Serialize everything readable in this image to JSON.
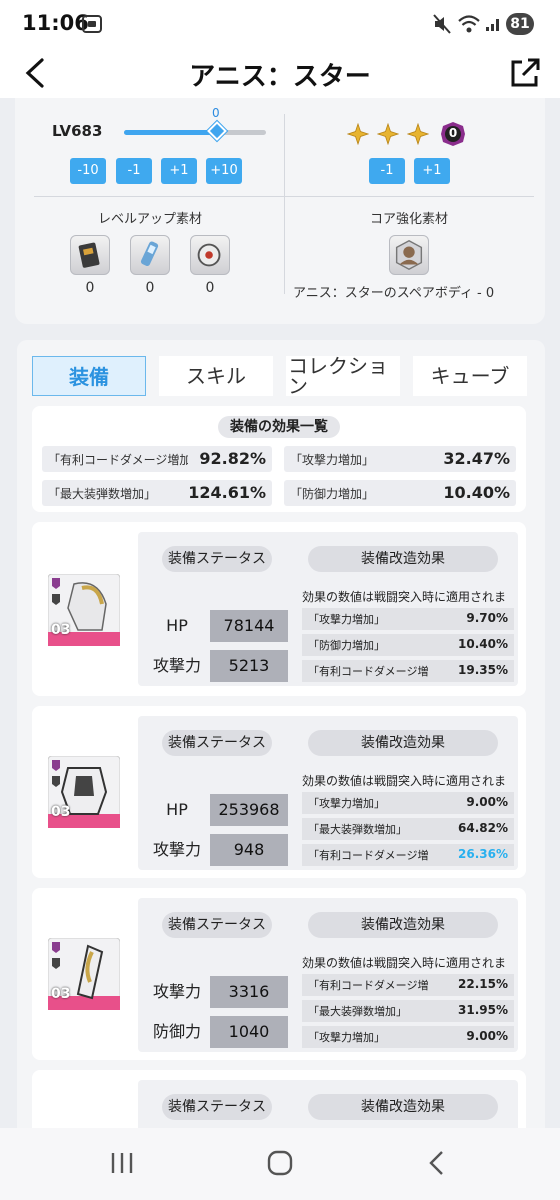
{
  "status": {
    "time": "11:06",
    "battery": "81"
  },
  "header": {
    "title": "アニス：スター"
  },
  "level": {
    "label": "LV683",
    "slider_value": "0",
    "slider_fraction": 0.62,
    "buttons": [
      "-10",
      "-1",
      "+1",
      "+10"
    ]
  },
  "core": {
    "stars": 3,
    "core_level": "0",
    "buttons": [
      "-1",
      "+1"
    ]
  },
  "levelup_materials": {
    "label": "レベルアップ素材",
    "counts": [
      "0",
      "0",
      "0"
    ]
  },
  "core_materials": {
    "label": "コア強化素材",
    "item_label": "アニス：スターのスペアボディ - 0"
  },
  "tabs": [
    "装備",
    "スキル",
    "コレクション",
    "キューブ"
  ],
  "summary": {
    "title": "装備の効果一覧",
    "rows": [
      {
        "label": "「有利コードダメージ増加",
        "value": "92.82%"
      },
      {
        "label": "「攻撃力増加」",
        "value": "32.47%"
      },
      {
        "label": "「最大装弾数増加」",
        "value": "124.61%"
      },
      {
        "label": "「防御力増加」",
        "value": "10.40%"
      }
    ]
  },
  "gear_common": {
    "stats_title": "装備ステータス",
    "effects_title": "装備改造効果",
    "note": "効果の数値は戦闘突入時に適用されま",
    "level_tag": "03"
  },
  "gears": [
    {
      "stats": [
        {
          "label": "HP",
          "value": "78144"
        },
        {
          "label": "攻撃力",
          "value": "5213"
        }
      ],
      "effects": [
        {
          "label": "「攻撃力増加」",
          "value": "9.70%",
          "hi": false
        },
        {
          "label": "「防御力増加」",
          "value": "10.40%",
          "hi": false
        },
        {
          "label": "「有利コードダメージ増",
          "value": "19.35%",
          "hi": false
        }
      ]
    },
    {
      "stats": [
        {
          "label": "HP",
          "value": "253968"
        },
        {
          "label": "攻撃力",
          "value": "948"
        }
      ],
      "effects": [
        {
          "label": "「攻撃力増加」",
          "value": "9.00%",
          "hi": false
        },
        {
          "label": "「最大装弾数増加」",
          "value": "64.82%",
          "hi": false
        },
        {
          "label": "「有利コードダメージ増",
          "value": "26.36%",
          "hi": true
        }
      ]
    },
    {
      "stats": [
        {
          "label": "攻撃力",
          "value": "3316"
        },
        {
          "label": "防御力",
          "value": "1040"
        }
      ],
      "effects": [
        {
          "label": "「有利コードダメージ増",
          "value": "22.15%",
          "hi": false
        },
        {
          "label": "「最大装弾数増加」",
          "value": "31.95%",
          "hi": false
        },
        {
          "label": "「攻撃力増加」",
          "value": "9.00%",
          "hi": false
        }
      ]
    }
  ],
  "colors": {
    "accent": "#3fa9ef",
    "highlight": "#29b0ef",
    "star": "#e7b431",
    "core": "#8a2d8c"
  }
}
